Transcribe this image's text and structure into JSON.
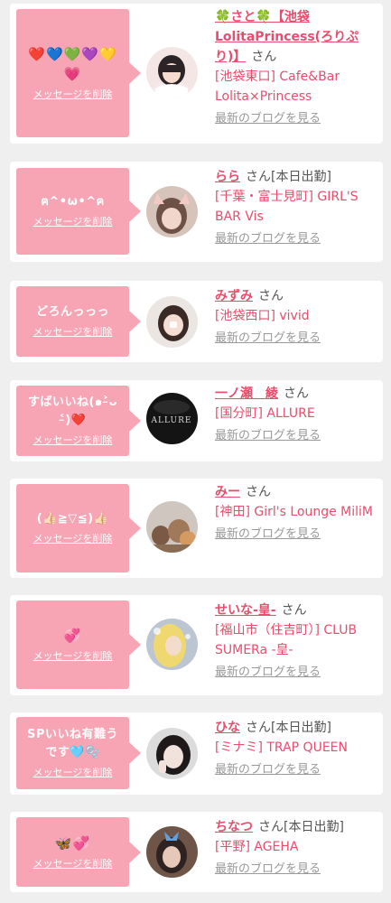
{
  "entries": [
    {
      "message": "❤️💙💚💜💛💗",
      "delete_label": "メッセージを削除",
      "name": "🍀さと🍀【池袋LolitaPrincess(ろりぷり)】",
      "san": "さん",
      "status": "",
      "shop": "[池袋東口] Cafe&Bar Lolita×Princess",
      "blog_label": "最新のブログを見る"
    },
    {
      "message": "ฅ^•ω•^ฅ",
      "delete_label": "メッセージを削除",
      "name": "らら",
      "san": "さん",
      "status": "[本日出勤]",
      "shop": "[千葉・富士見町] GIRL'S BAR Vis",
      "blog_label": "最新のブログを見る"
    },
    {
      "message": "どろんっっっ",
      "delete_label": "メッセージを削除",
      "name": "みずみ",
      "san": "さん",
      "status": "",
      "shop": "[池袋西口] vivid",
      "blog_label": "最新のブログを見る"
    },
    {
      "message": "すばいいね(๑˃̵ᴗ˂̵)❤️",
      "delete_label": "メッセージを削除",
      "name": "一ノ瀬　綾",
      "san": "さん",
      "status": "",
      "shop": "[国分町] ALLURE",
      "blog_label": "最新のブログを見る"
    },
    {
      "message": "(👍🏻≧▽≦)👍🏻",
      "delete_label": "メッセージを削除",
      "name": "みー",
      "san": "さん",
      "status": "",
      "shop": "[神田] Girl's Lounge MiliM",
      "blog_label": "最新のブログを見る"
    },
    {
      "message": "💞",
      "delete_label": "メッセージを削除",
      "name": "せいな-皇-",
      "san": "さん",
      "status": "",
      "shop": "[福山市（住吉町）] CLUB SUMERa -皇-",
      "blog_label": "最新のブログを見る"
    },
    {
      "message": "SPいいね有難うです🩵🫧",
      "delete_label": "メッセージを削除",
      "name": "ひな",
      "san": "さん",
      "status": "[本日出勤]",
      "shop": "[ミナミ] TRAP QUEEN",
      "blog_label": "最新のブログを見る"
    },
    {
      "message": "🦋💞",
      "delete_label": "メッセージを削除",
      "name": "ちなつ",
      "san": "さん",
      "status": "[本日出勤]",
      "shop": "[平野] AGEHA",
      "blog_label": "最新のブログを見る"
    }
  ],
  "avatar_text": {
    "allure": "ALLURE"
  },
  "colors": {
    "bubble": "#f7a5b5",
    "accent": "#e94d6c",
    "muted": "#999999",
    "background": "#efefef"
  }
}
